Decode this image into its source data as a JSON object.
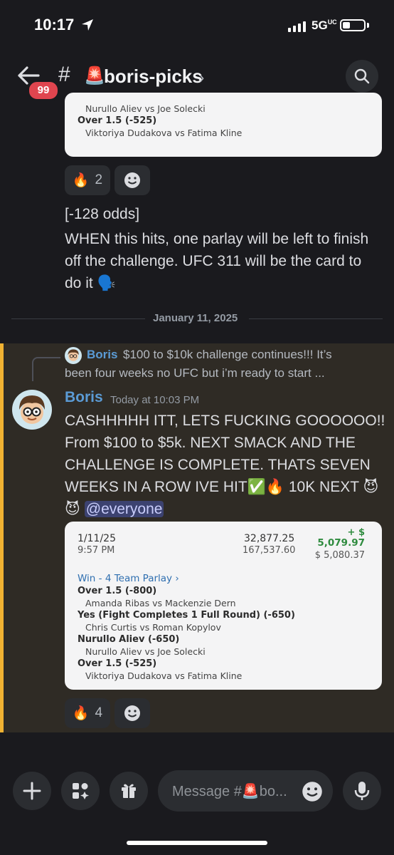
{
  "status": {
    "time": "10:17",
    "network": "5G",
    "network_sub": "UC"
  },
  "header": {
    "unread_badge": "99",
    "channel_name": "boris-picks"
  },
  "top_card": {
    "lines": [
      {
        "text": "Nurullo Aliev vs Joe Solecki",
        "style": "sub"
      },
      {
        "text": "Over 1.5 (-525)",
        "style": "bold"
      },
      {
        "text": "Viktoriya Dudakova vs Fatima Kline",
        "style": "sub"
      }
    ]
  },
  "reactions_top": {
    "emoji": "🔥",
    "count": "2"
  },
  "prev_message": {
    "odds": "[-128 odds]",
    "line1": "WHEN this hits, one parlay will be left to finish",
    "line2": "off the challenge. UFC 311 will be the card to",
    "line3": "do it 🗣️"
  },
  "date_divider": "January 11, 2025",
  "reply": {
    "author": "Boris",
    "text1": "$100 to $10k challenge continues!!! It’s",
    "text2": "been four weeks no UFC but i’m ready to start ..."
  },
  "message": {
    "author": "Boris",
    "timestamp": "Today at 10:03 PM",
    "line1": "CASHHHHH ITT, LETS FUCKING GOOOOOO!!",
    "line2": "From $100 to $5k. NEXT SMACK AND THE",
    "line3": "CHALLENGE IS COMPLETE. THATS SEVEN",
    "line4": "WEEKS IN A ROW IVE HIT✅🔥 10K NEXT 😈",
    "line5_emoji": "😈",
    "mention": "@everyone"
  },
  "bet_card": {
    "date": "1/11/25",
    "time": "9:57 PM",
    "num1": "32,877.25",
    "num2": "167,537.60",
    "plus_label": "+ $",
    "win_amount": "5,079.97",
    "balance": "$ 5,080.37",
    "parlay_label": "Win - 4 Team Parlay",
    "lines": [
      {
        "text": "Over 1.5 (-800)",
        "style": "bold"
      },
      {
        "text": "Amanda Ribas vs Mackenzie Dern",
        "style": "sub"
      },
      {
        "text": "Yes (Fight Completes 1 Full Round) (-650)",
        "style": "bold"
      },
      {
        "text": "Chris Curtis vs Roman Kopylov",
        "style": "sub"
      },
      {
        "text": "Nurullo Aliev (-650)",
        "style": "bold"
      },
      {
        "text": "Nurullo Aliev vs Joe Solecki",
        "style": "sub"
      },
      {
        "text": "Over 1.5 (-525)",
        "style": "bold"
      },
      {
        "text": "Viktoriya Dudakova vs Fatima Kline",
        "style": "sub"
      }
    ]
  },
  "reactions_bottom": {
    "emoji": "🔥",
    "count": "4"
  },
  "composer": {
    "placeholder": "Message #🚨bo..."
  },
  "colors": {
    "accent": "#5b9bd5",
    "highlight_bar": "#f0b232",
    "badge": "#e0454f",
    "win_green": "#2e8b3e"
  }
}
